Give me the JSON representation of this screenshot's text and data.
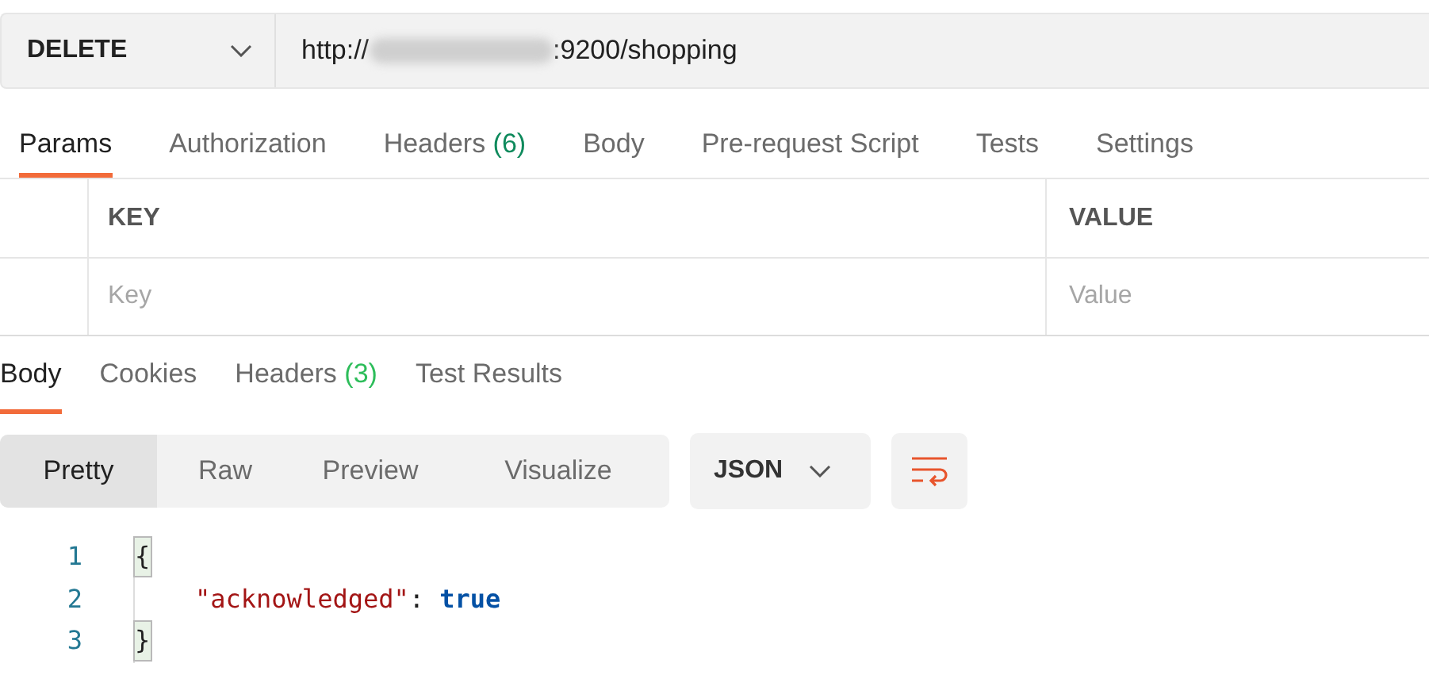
{
  "request": {
    "method": "DELETE",
    "url_prefix": "http://",
    "url_suffix": ":9200/shopping"
  },
  "request_tabs": [
    {
      "label": "Params",
      "selected": true
    },
    {
      "label": "Authorization",
      "selected": false
    },
    {
      "label": "Headers",
      "count": "(6)",
      "selected": false
    },
    {
      "label": "Body",
      "selected": false
    },
    {
      "label": "Pre-request Script",
      "selected": false
    },
    {
      "label": "Tests",
      "selected": false
    },
    {
      "label": "Settings",
      "selected": false
    }
  ],
  "params_table": {
    "columns": [
      "KEY",
      "VALUE"
    ],
    "placeholders": [
      "Key",
      "Value"
    ]
  },
  "response_tabs": [
    {
      "label": "Body",
      "selected": true
    },
    {
      "label": "Cookies",
      "selected": false
    },
    {
      "label": "Headers",
      "count": "(3)",
      "selected": false
    },
    {
      "label": "Test Results",
      "selected": false
    }
  ],
  "view_modes": [
    {
      "label": "Pretty",
      "selected": true
    },
    {
      "label": "Raw",
      "selected": false
    },
    {
      "label": "Preview",
      "selected": false
    },
    {
      "label": "Visualize",
      "selected": false
    }
  ],
  "format": "JSON",
  "code_lines": [
    {
      "number": "1",
      "tokens": [
        {
          "kind": "brace",
          "text": "{",
          "matched": true
        }
      ]
    },
    {
      "number": "2",
      "tokens": [
        {
          "kind": "key",
          "text": "\"acknowledged\""
        },
        {
          "kind": "punct",
          "text": ": "
        },
        {
          "kind": "bool",
          "text": "true"
        }
      ]
    },
    {
      "number": "3",
      "tokens": [
        {
          "kind": "brace",
          "text": "}",
          "matched": true
        }
      ]
    }
  ]
}
